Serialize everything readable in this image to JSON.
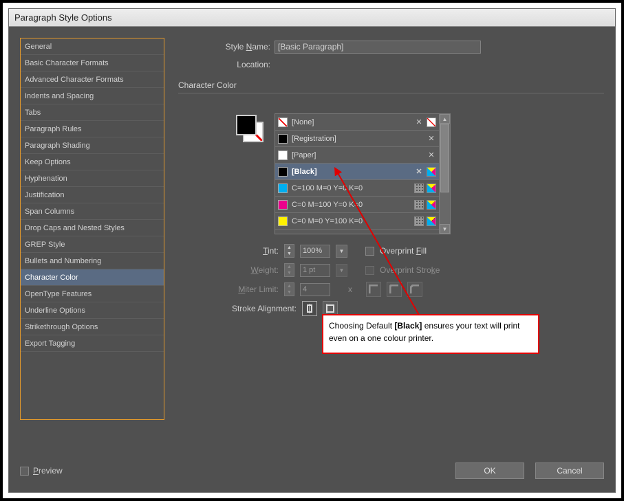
{
  "window": {
    "title": "Paragraph Style Options"
  },
  "sidebar": {
    "items": [
      "General",
      "Basic Character Formats",
      "Advanced Character Formats",
      "Indents and Spacing",
      "Tabs",
      "Paragraph Rules",
      "Paragraph Shading",
      "Keep Options",
      "Hyphenation",
      "Justification",
      "Span Columns",
      "Drop Caps and Nested Styles",
      "GREP Style",
      "Bullets and Numbering",
      "Character Color",
      "OpenType Features",
      "Underline Options",
      "Strikethrough Options",
      "Export Tagging"
    ],
    "selected_index": 14
  },
  "form": {
    "style_name_label_pre": "Style ",
    "style_name_label_u": "N",
    "style_name_label_post": "ame:",
    "style_name_value": "[Basic Paragraph]",
    "location_label": "Location:",
    "section_title": "Character Color",
    "tint_label_u": "T",
    "tint_label_post": "int:",
    "tint_value": "100%",
    "overprint_fill_pre": "Overprint ",
    "overprint_fill_u": "F",
    "overprint_fill_post": "ill",
    "weight_label_u": "W",
    "weight_label_post": "eight:",
    "weight_value": "1 pt",
    "overprint_stroke_pre": "Overprint Stro",
    "overprint_stroke_u": "k",
    "overprint_stroke_post": "e",
    "miter_label_post": "iter Limit:",
    "miter_label_u": "M",
    "miter_value": "4",
    "miter_x": "x",
    "stroke_align_label": "Stroke Alignment:"
  },
  "swatches": {
    "items": [
      {
        "name": "[None]",
        "color": "none",
        "editable": false,
        "cmyk": false,
        "none_icon": true
      },
      {
        "name": "[Registration]",
        "color": "reg",
        "editable": false,
        "cmyk": false,
        "none_icon": false
      },
      {
        "name": "[Paper]",
        "color": "paper",
        "editable": false,
        "cmyk": false,
        "none_icon": false
      },
      {
        "name": "[Black]",
        "color": "black",
        "editable": false,
        "cmyk": true,
        "none_icon": false
      },
      {
        "name": "C=100 M=0 Y=0 K=0",
        "color": "cyan",
        "editable": true,
        "cmyk": true,
        "none_icon": false
      },
      {
        "name": "C=0 M=100 Y=0 K=0",
        "color": "magenta",
        "editable": true,
        "cmyk": true,
        "none_icon": false
      },
      {
        "name": "C=0 M=0 Y=100 K=0",
        "color": "yellow",
        "editable": true,
        "cmyk": true,
        "none_icon": false
      }
    ],
    "selected_index": 3
  },
  "buttons": {
    "ok": "OK",
    "cancel": "Cancel",
    "preview_label_u": "P",
    "preview_label_post": "review"
  },
  "annotation": {
    "text_pre": "Choosing Default ",
    "text_bold": "[Black]",
    "text_post": " ensures your text will print even on a one colour printer."
  }
}
